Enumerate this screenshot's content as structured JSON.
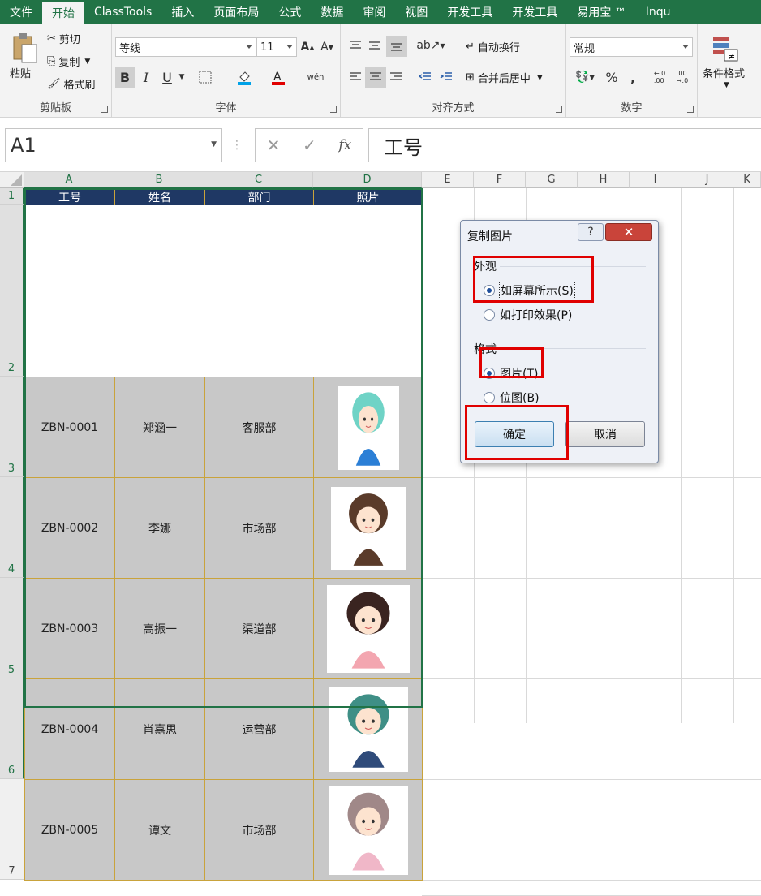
{
  "ribbon": {
    "tabs": [
      {
        "label": "文件",
        "active": false
      },
      {
        "label": "开始",
        "active": true
      },
      {
        "label": "ClassTools",
        "active": false
      },
      {
        "label": "插入",
        "active": false
      },
      {
        "label": "页面布局",
        "active": false
      },
      {
        "label": "公式",
        "active": false
      },
      {
        "label": "数据",
        "active": false
      },
      {
        "label": "审阅",
        "active": false
      },
      {
        "label": "视图",
        "active": false
      },
      {
        "label": "开发工具",
        "active": false
      },
      {
        "label": "开发工具",
        "active": false
      },
      {
        "label": "易用宝 ™",
        "active": false
      },
      {
        "label": "Inqu",
        "active": false
      }
    ],
    "clipboard": {
      "label": "剪贴板",
      "paste": "粘贴",
      "cut": "剪切",
      "copy": "复制",
      "format_painter": "格式刷"
    },
    "font": {
      "label": "字体",
      "name": "等线",
      "size": "11",
      "bold": "B",
      "italic": "I",
      "underline": "U"
    },
    "alignment": {
      "label": "对齐方式",
      "wrap": "自动换行",
      "merge": "合并后居中"
    },
    "number": {
      "label": "数字",
      "format": "常规",
      "percent": "%",
      "comma": ","
    },
    "styles": {
      "conditional": "条件格式"
    }
  },
  "formula_bar": {
    "namebox": "A1",
    "cancel": "✕",
    "enter": "✓",
    "fx": "fx",
    "value": "工号"
  },
  "sheet": {
    "columns": [
      "A",
      "B",
      "C",
      "D",
      "E",
      "F",
      "G",
      "H",
      "I",
      "J",
      "K"
    ],
    "rows": [
      "1",
      "2",
      "3",
      "4",
      "5",
      "6",
      "7"
    ],
    "headers": [
      "工号",
      "姓名",
      "部门",
      "照片"
    ],
    "records": [
      {
        "id": "ZBN-0001",
        "name": "郑涵一",
        "dept": "客服部"
      },
      {
        "id": "ZBN-0002",
        "name": "李娜",
        "dept": "市场部"
      },
      {
        "id": "ZBN-0003",
        "name": "高振一",
        "dept": "渠道部"
      },
      {
        "id": "ZBN-0004",
        "name": "肖嘉思",
        "dept": "运营部"
      },
      {
        "id": "ZBN-0005",
        "name": "谭文",
        "dept": "市场部"
      }
    ]
  },
  "dialog": {
    "title": "复制图片",
    "help": "?",
    "close": "✕",
    "appearance_label": "外观",
    "as_shown_screen": "如屏幕所示(S)",
    "as_shown_print": "如打印效果(P)",
    "format_label": "格式",
    "picture": "图片(T)",
    "bitmap": "位图(B)",
    "ok": "确定",
    "cancel": "取消",
    "selected_appearance": "as_shown_screen",
    "selected_format": "picture"
  },
  "colors": {
    "accent": "#217346",
    "header_fill": "#1f3864",
    "cell_fill": "#c8c8c8",
    "border": "#c9a33b",
    "highlight": "#e00000"
  }
}
